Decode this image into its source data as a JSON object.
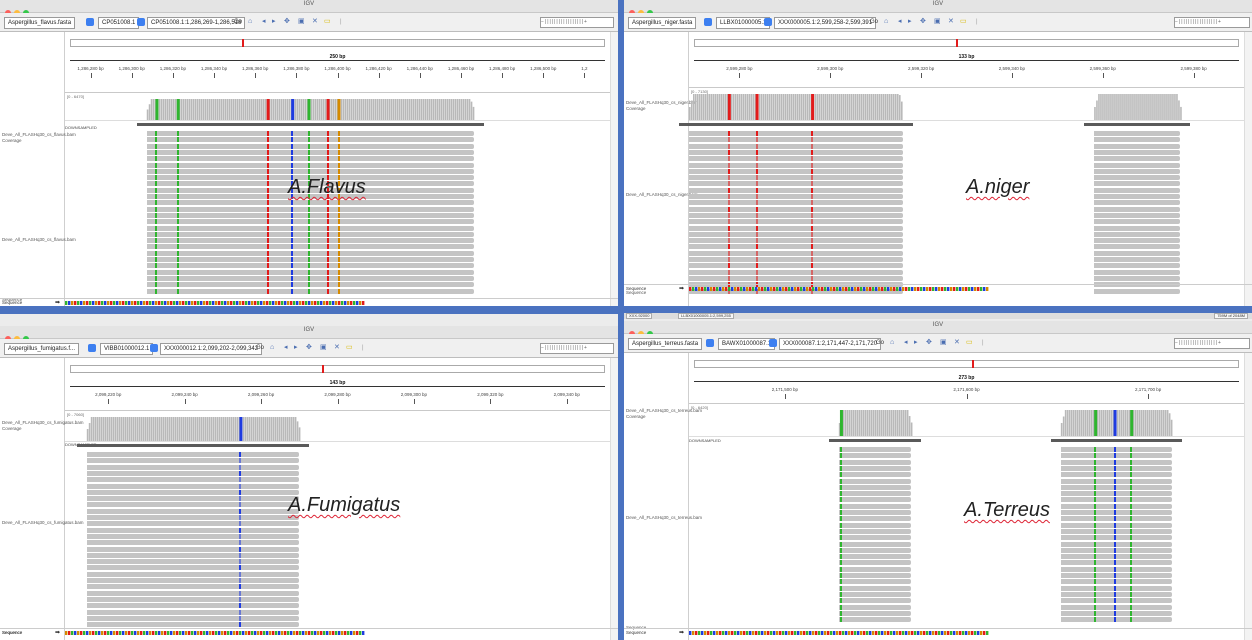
{
  "colors": {
    "base_A": "#2fb52f",
    "base_C": "#1f3be0",
    "base_G": "#d58a00",
    "base_T": "#e21b1b",
    "read": "#c4c4c4",
    "coverage": "#b9b9b9",
    "chromosome_marker": "#e21b1b",
    "divider": "#4a72c0"
  },
  "panels": [
    {
      "id": "flavus",
      "window_title": "IGV",
      "genome": "Aspergillus_flavus.fasta",
      "chromosome": "CP051008.1",
      "locus": "CP051008.1:1,286,269-1,286,518",
      "go_label": "Go",
      "span_label": "250 bp",
      "ticks": [
        "1,286,280 bp",
        "1,286,300 bp",
        "1,286,320 bp",
        "1,286,340 bp",
        "1,286,360 bp",
        "1,286,380 bp",
        "1,286,400 bp",
        "1,286,420 bp",
        "1,286,440 bp",
        "1,286,460 bp",
        "1,286,480 bp",
        "1,286,500 bp",
        "1,2"
      ],
      "coverage_label": "Deve_All_FLASHq30_cs_flavus.bam Coverage",
      "coverage_scale": "[0 - 6470]",
      "downsample_label": "DOWNSAMPLED",
      "alignment_label": "Deve_All_FLASHq30_cs_flavus.bam",
      "sequence_label": "Sequence",
      "species_label": "A.Flavus"
    },
    {
      "id": "niger",
      "window_title": "IGV",
      "genome": "Aspergillus_niger.fasta",
      "chromosome": "LLBX01000005.1",
      "locus": "XXX000005.1:2,599,258-2,599,391",
      "go_label": "Go",
      "span_label": "133 bp",
      "ticks": [
        "2,599,280 bp",
        "2,599,300 bp",
        "2,599,320 bp",
        "2,599,340 bp",
        "2,599,360 bp",
        "2,599,380 bp"
      ],
      "coverage_label": "Deve_All_FLASHq30_cs_niger.bam Coverage",
      "coverage_scale": "[0 - 7130]",
      "downsample_label": "DOWNSAMPLED",
      "alignment_label": "Deve_All_FLASHq30_cs_niger.bam",
      "sequence_label": "Sequence",
      "species_label": "A.niger"
    },
    {
      "id": "fumigatus",
      "window_title": "IGV",
      "genome": "Aspergillus_fumigatus.f...",
      "chromosome": "VIBB01000012.1",
      "locus": "XXX000012.1:2,099,202-2,099,342",
      "go_label": "Go",
      "span_label": "143 bp",
      "ticks": [
        "2,099,220 bp",
        "2,099,240 bp",
        "2,099,260 bp",
        "2,099,280 bp",
        "2,099,300 bp",
        "2,099,320 bp",
        "2,099,340 bp"
      ],
      "coverage_label": "Deve_All_FLASHq30_cs_fumigatus.bam Coverage",
      "coverage_scale": "[0 - 7060]",
      "downsample_label": "DOWNSAMPLED",
      "alignment_label": "Deve_All_FLASHq30_cs_fumigatus.bam",
      "sequence_label": "Sequence",
      "species_label": "A.Fumigatus"
    },
    {
      "id": "terreus",
      "window_title": "IGV",
      "genome": "Aspergillus_terreus.fasta",
      "chromosome": "BAWX01000087.1",
      "locus": "XXX000087.1:2,171,447-2,171,720",
      "go_label": "Go",
      "span_label": "273 bp",
      "ticks": [
        "2,171,500 bp",
        "2,171,600 bp",
        "2,171,700 bp"
      ],
      "coverage_label": "Deve_All_FLASHq30_cs_terreus.bam Coverage",
      "coverage_scale": "[0 - 6420]",
      "downsample_label": "DOWNSAMPLED",
      "alignment_label": "Deve_All_FLASHq30_cs_terreus.bam",
      "sequence_label": "Sequence",
      "species_label": "A.Terreus"
    }
  ],
  "status_bar": {
    "left": "XXX-92000",
    "middle": "LLBX01000005.1:2,599,255",
    "right": "759M of 2048M"
  }
}
